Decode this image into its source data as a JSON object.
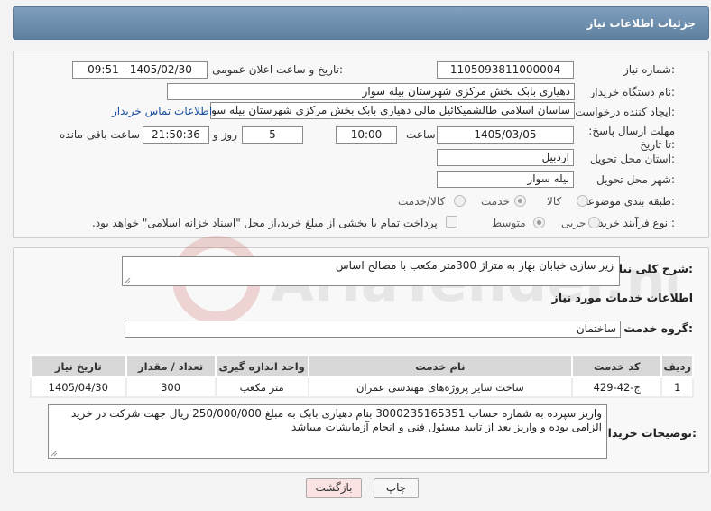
{
  "header": {
    "title": "جزئیات اطلاعات نیاز"
  },
  "form": {
    "need_number_label": "شماره نیاز:",
    "need_number": "1105093811000004",
    "announce_label": "تاریخ و ساعت اعلان عمومی:",
    "announce_value": "1405/02/30 - 09:51",
    "buyer_org_label": "نام دستگاه خریدار:",
    "buyer_org": "دهیاری بابک بخش مرکزی شهرستان بیله سوار",
    "creator_label": "ایجاد کننده درخواست:",
    "creator": "ساسان اسلامی طالشمیکائیل مالی دهیاری بابک بخش مرکزی شهرستان بیله سوار",
    "contact_link": "اطلاعات تماس خریدار",
    "deadline_label": "مهلت ارسال پاسخ: تا تاریخ:",
    "deadline_date": "1405/03/05",
    "time_label": "ساعت",
    "deadline_time": "10:00",
    "days_value": "5",
    "days_label": "روز و",
    "remaining_time": "21:50:36",
    "remaining_label": "ساعت باقی مانده",
    "province_label": "استان محل تحویل:",
    "province": "اردبیل",
    "city_label": "شهر محل تحویل:",
    "city": "بیله سوار",
    "category_label": "طبقه بندی موضوعی:",
    "category_options": [
      "کالا",
      "خدمت",
      "کالا/خدمت"
    ],
    "category_selected": "خدمت",
    "process_label": "نوع فرآیند خرید :",
    "process_options": [
      "جزیی",
      "متوسط"
    ],
    "process_selected": "متوسط",
    "payment_note": "پرداخت تمام یا بخشی از مبلغ خرید،از محل \"اسناد خزانه اسلامی\" خواهد بود."
  },
  "summary": {
    "label": "شرح کلی نیاز:",
    "text": "زیر سازی خیابان بهار به متراژ 300متر مکعب با مصالح اساس"
  },
  "services": {
    "section_title": "اطلاعات خدمات مورد نیاز",
    "group_label": "گروه خدمت:",
    "group_value": "ساختمان",
    "columns": [
      "ردیف",
      "کد خدمت",
      "نام خدمت",
      "واحد اندازه گیری",
      "تعداد / مقدار",
      "تاریخ نیاز"
    ],
    "rows": [
      {
        "row": "1",
        "code": "ج-42-429",
        "name": "ساخت سایر پروژه‌های مهندسی عمران",
        "unit": "متر مکعب",
        "qty": "300",
        "date": "1405/04/30"
      }
    ]
  },
  "buyer_notes": {
    "label": "توضیحات خریدار:",
    "text": "واریز سپرده به شماره حساب 3000235165351 بنام دهیاری بابک  به مبلغ 250/000/000 ریال جهت شرکت در خرید الزامی بوده و واریز بعد از تایید مسئول فنی و انجام آزمایشات میباشد"
  },
  "buttons": {
    "print": "چاپ",
    "back": "بازگشت"
  },
  "watermark": {
    "text": "AriaTender.neT"
  },
  "colors": {
    "header": "#6f8fae",
    "link": "#1a4fa0",
    "back_button": "#fbe3e3"
  }
}
